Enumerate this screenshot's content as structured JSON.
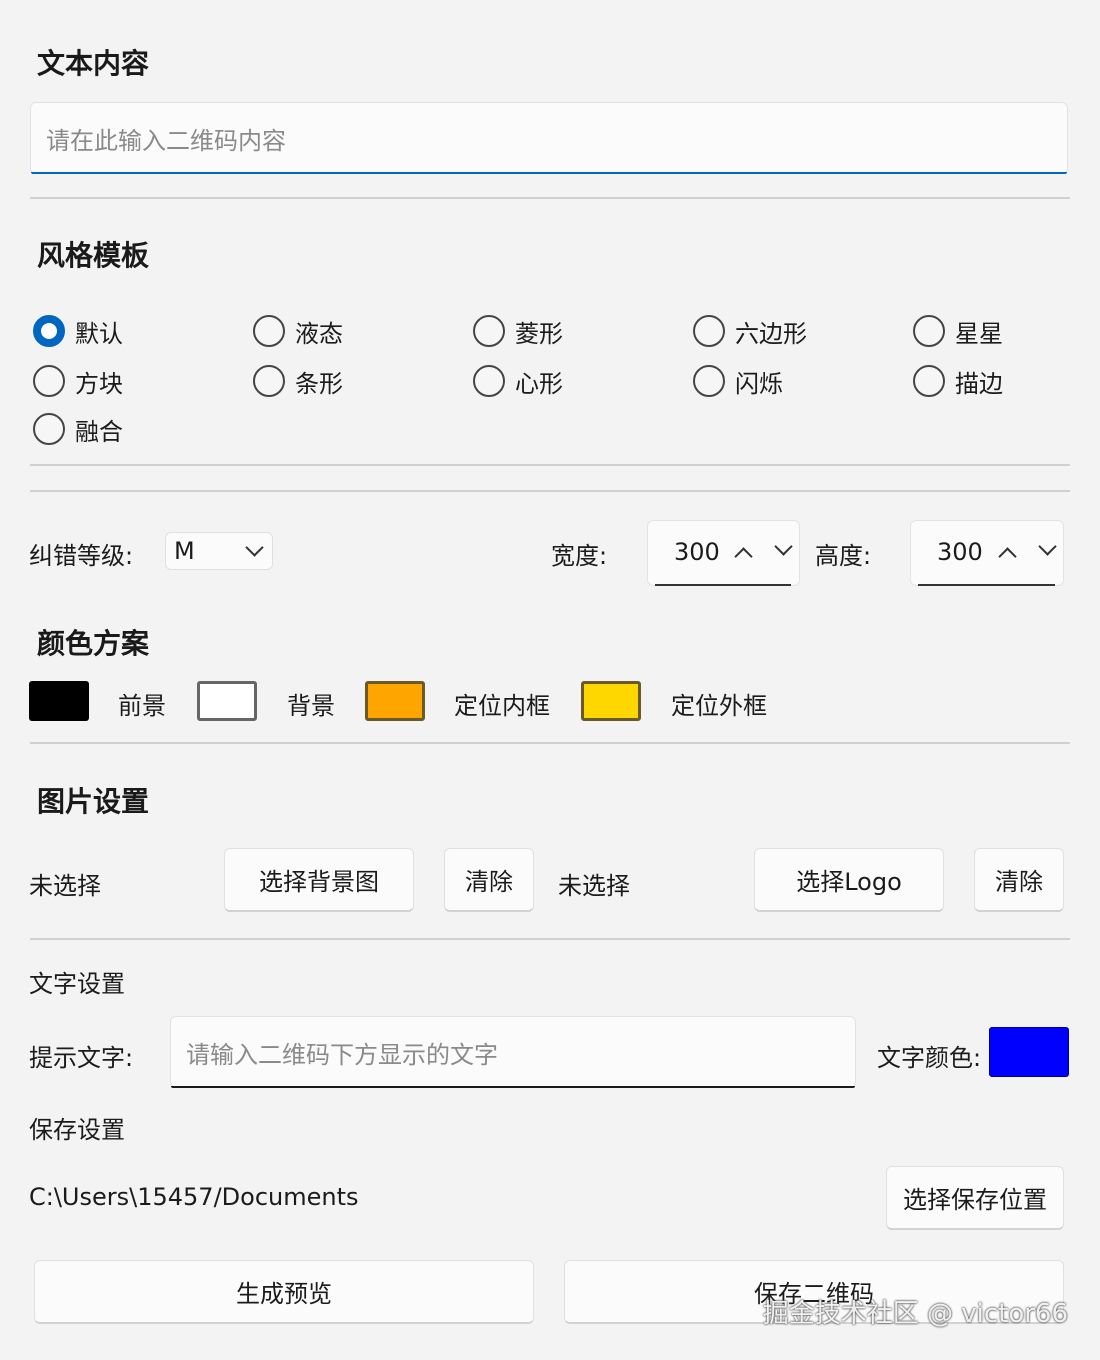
{
  "text_section": {
    "title": "文本内容",
    "input_placeholder": "请在此输入二维码内容"
  },
  "style_section": {
    "title": "风格模板",
    "selected": "默认",
    "options": [
      "默认",
      "液态",
      "菱形",
      "六边形",
      "星星",
      "方块",
      "条形",
      "心形",
      "闪烁",
      "描边",
      "融合"
    ]
  },
  "params": {
    "ecc_label": "纠错等级:",
    "ecc_value": "M",
    "width_label": "宽度:",
    "width_value": "300",
    "height_label": "高度:",
    "height_value": "300"
  },
  "color_section": {
    "title": "颜色方案",
    "foreground": {
      "label": "前景",
      "color": "#000000"
    },
    "background": {
      "label": "背景",
      "color": "#ffffff"
    },
    "inner_finder": {
      "label": "定位内框",
      "color": "#ffa500"
    },
    "outer_finder": {
      "label": "定位外框",
      "color": "#ffd700"
    }
  },
  "image_section": {
    "title": "图片设置",
    "bg_status": "未选择",
    "bg_select_label": "选择背景图",
    "bg_clear_label": "清除",
    "logo_status": "未选择",
    "logo_select_label": "选择Logo",
    "logo_clear_label": "清除"
  },
  "text_settings": {
    "title": "文字设置",
    "hint_label": "提示文字:",
    "hint_placeholder": "请输入二维码下方显示的文字",
    "color_label": "文字颜色:",
    "color": "#0000ff"
  },
  "save_settings": {
    "title": "保存设置",
    "path": "C:\\Users\\15457/Documents",
    "choose_label": "选择保存位置"
  },
  "actions": {
    "preview_label": "生成预览",
    "save_label": "保存二维码"
  },
  "watermark": "掘金技术社区 @ victor66",
  "colors": {
    "accent": "#0067c0"
  }
}
